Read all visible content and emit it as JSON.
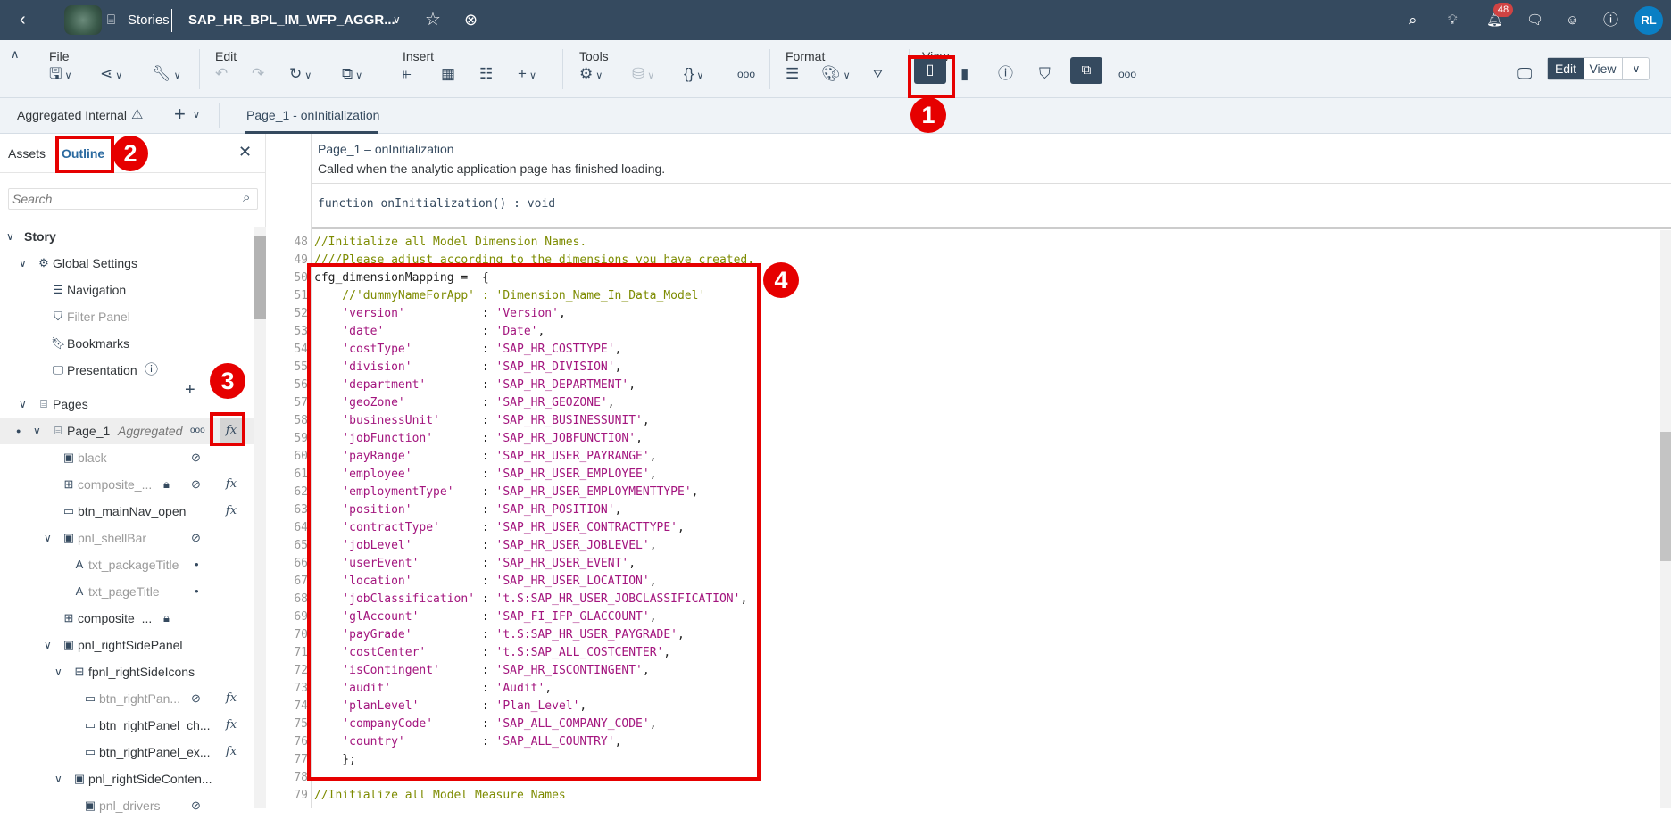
{
  "topbar": {
    "stories_label": "Stories",
    "story_title": "SAP_HR_BPL_IM_WFP_AGGR...",
    "notification_count": "48",
    "avatar_initials": "RL"
  },
  "toolbar": {
    "groups": {
      "file": "File",
      "edit": "Edit",
      "insert": "Insert",
      "tools": "Tools",
      "format": "Format",
      "view": "View"
    },
    "mode_edit": "Edit",
    "mode_view": "View"
  },
  "tabrow": {
    "model_name": "Aggregated Internal",
    "active_tab": "Page_1 - onInitialization"
  },
  "left_panel": {
    "tab_assets": "Assets",
    "tab_outline": "Outline",
    "search_placeholder": "Search",
    "tree": [
      {
        "label": "Story",
        "level": 0,
        "chevron": true,
        "bold": true
      },
      {
        "label": "Global Settings",
        "level": 1,
        "chevron": true,
        "icon": "gear-icon"
      },
      {
        "label": "Navigation",
        "level": 2,
        "icon": "menu-icon"
      },
      {
        "label": "Filter Panel",
        "level": 2,
        "icon": "filter-icon",
        "dim": true
      },
      {
        "label": "Bookmarks",
        "level": 2,
        "icon": "bookmark-icon"
      },
      {
        "label": "Presentation",
        "level": 2,
        "icon": "monitor-icon",
        "info": true
      },
      {
        "label": "Pages",
        "level": 1,
        "chevron": true,
        "icon": "page-icon",
        "add": true
      },
      {
        "label": "Page_1",
        "sub": "Aggregated",
        "level": 2,
        "chevron": true,
        "icon": "page-icon",
        "selected": true,
        "more": true,
        "fx": true
      },
      {
        "label": "black",
        "level": 3,
        "icon": "panel-icon",
        "dim": true,
        "hidden": true
      },
      {
        "label": "composite_...",
        "level": 3,
        "icon": "composite-icon",
        "dim": true,
        "lock": true,
        "hidden": true,
        "fx": true
      },
      {
        "label": "btn_mainNav_open",
        "level": 3,
        "icon": "button-icon",
        "fx": true
      },
      {
        "label": "pnl_shellBar",
        "level": 3,
        "chevron": true,
        "icon": "panel-icon",
        "dim": true,
        "hidden": true
      },
      {
        "label": "txt_packageTitle",
        "level": 4,
        "icon": "text-icon",
        "dim": true,
        "dot": true
      },
      {
        "label": "txt_pageTitle",
        "level": 4,
        "icon": "text-icon",
        "dim": true,
        "dot": true
      },
      {
        "label": "composite_...",
        "level": 3,
        "icon": "composite-icon",
        "lock": true
      },
      {
        "label": "pnl_rightSidePanel",
        "level": 3,
        "chevron": true,
        "icon": "panel-icon"
      },
      {
        "label": "fpnl_rightSideIcons",
        "level": 4,
        "chevron": true,
        "icon": "flow-panel-icon"
      },
      {
        "label": "btn_rightPan...",
        "level": 5,
        "icon": "button-icon",
        "dim": true,
        "hidden": true,
        "fx": true
      },
      {
        "label": "btn_rightPanel_ch...",
        "level": 5,
        "icon": "button-icon",
        "fx": true
      },
      {
        "label": "btn_rightPanel_ex...",
        "level": 5,
        "icon": "button-icon",
        "fx": true
      },
      {
        "label": "pnl_rightSideConten...",
        "level": 4,
        "chevron": true,
        "icon": "panel-icon"
      },
      {
        "label": "pnl_drivers",
        "level": 5,
        "icon": "panel-icon",
        "dim": true,
        "hidden": true
      }
    ]
  },
  "editor": {
    "event_title": "Page_1 – onInitialization",
    "event_desc": "Called when the analytic application page has finished loading.",
    "signature": "function onInitialization() : void",
    "lines": [
      {
        "n": "48",
        "t": "comment",
        "text": "//Initialize all Model Dimension Names."
      },
      {
        "n": "49",
        "t": "comment",
        "text": "////Please adjust according to the dimensions you have created."
      },
      {
        "n": "50",
        "t": "plain",
        "text": "cfg_dimensionMapping =  {"
      },
      {
        "n": "51",
        "t": "comment",
        "text": "    //'dummyNameForApp' : 'Dimension_Name_In_Data_Model'"
      },
      {
        "n": "52",
        "t": "map",
        "k": "'version'",
        "v": "'Version'"
      },
      {
        "n": "53",
        "t": "map",
        "k": "'date'",
        "v": "'Date'"
      },
      {
        "n": "54",
        "t": "map",
        "k": "'costType'",
        "v": "'SAP_HR_COSTTYPE'"
      },
      {
        "n": "55",
        "t": "map",
        "k": "'division'",
        "v": "'SAP_HR_DIVISION'"
      },
      {
        "n": "56",
        "t": "map",
        "k": "'department'",
        "v": "'SAP_HR_DEPARTMENT'"
      },
      {
        "n": "57",
        "t": "map",
        "k": "'geoZone'",
        "v": "'SAP_HR_GEOZONE'"
      },
      {
        "n": "58",
        "t": "map",
        "k": "'businessUnit'",
        "v": "'SAP_HR_BUSINESSUNIT'"
      },
      {
        "n": "59",
        "t": "map",
        "k": "'jobFunction'",
        "v": "'SAP_HR_JOBFUNCTION'"
      },
      {
        "n": "60",
        "t": "map",
        "k": "'payRange'",
        "v": "'SAP_HR_USER_PAYRANGE'"
      },
      {
        "n": "61",
        "t": "map",
        "k": "'employee'",
        "v": "'SAP_HR_USER_EMPLOYEE'"
      },
      {
        "n": "62",
        "t": "map",
        "k": "'employmentType'",
        "v": "'SAP_HR_USER_EMPLOYMENTTYPE'"
      },
      {
        "n": "63",
        "t": "map",
        "k": "'position'",
        "v": "'SAP_HR_POSITION'"
      },
      {
        "n": "64",
        "t": "map",
        "k": "'contractType'",
        "v": "'SAP_HR_USER_CONTRACTTYPE'"
      },
      {
        "n": "65",
        "t": "map",
        "k": "'jobLevel'",
        "v": "'SAP_HR_USER_JOBLEVEL'"
      },
      {
        "n": "66",
        "t": "map",
        "k": "'userEvent'",
        "v": "'SAP_HR_USER_EVENT'"
      },
      {
        "n": "67",
        "t": "map",
        "k": "'location'",
        "v": "'SAP_HR_USER_LOCATION'"
      },
      {
        "n": "68",
        "t": "map",
        "k": "'jobClassification'",
        "v": "'t.S:SAP_HR_USER_JOBCLASSIFICATION'"
      },
      {
        "n": "69",
        "t": "map",
        "k": "'glAccount'",
        "v": "'SAP_FI_IFP_GLACCOUNT'"
      },
      {
        "n": "70",
        "t": "map",
        "k": "'payGrade'",
        "v": "'t.S:SAP_HR_USER_PAYGRADE'"
      },
      {
        "n": "71",
        "t": "map",
        "k": "'costCenter'",
        "v": "'t.S:SAP_ALL_COSTCENTER'"
      },
      {
        "n": "72",
        "t": "map",
        "k": "'isContingent'",
        "v": "'SAP_HR_ISCONTINGENT'"
      },
      {
        "n": "73",
        "t": "map",
        "k": "'audit'",
        "v": "'Audit'"
      },
      {
        "n": "74",
        "t": "map",
        "k": "'planLevel'",
        "v": "'Plan_Level'"
      },
      {
        "n": "75",
        "t": "map",
        "k": "'companyCode'",
        "v": "'SAP_ALL_COMPANY_CODE'"
      },
      {
        "n": "76",
        "t": "map",
        "k": "'country'",
        "v": "'SAP_ALL_COUNTRY'"
      },
      {
        "n": "77",
        "t": "plain",
        "text": "    };"
      },
      {
        "n": "78",
        "t": "plain",
        "text": ""
      },
      {
        "n": "79",
        "t": "comment",
        "text": "//Initialize all Model Measure Names"
      }
    ]
  },
  "annotations": [
    "1",
    "2",
    "3",
    "4"
  ],
  "colors": {
    "shell": "#354a5f",
    "annotation": "#e60000",
    "comment": "#7d8b00",
    "string": "#a3157e"
  }
}
